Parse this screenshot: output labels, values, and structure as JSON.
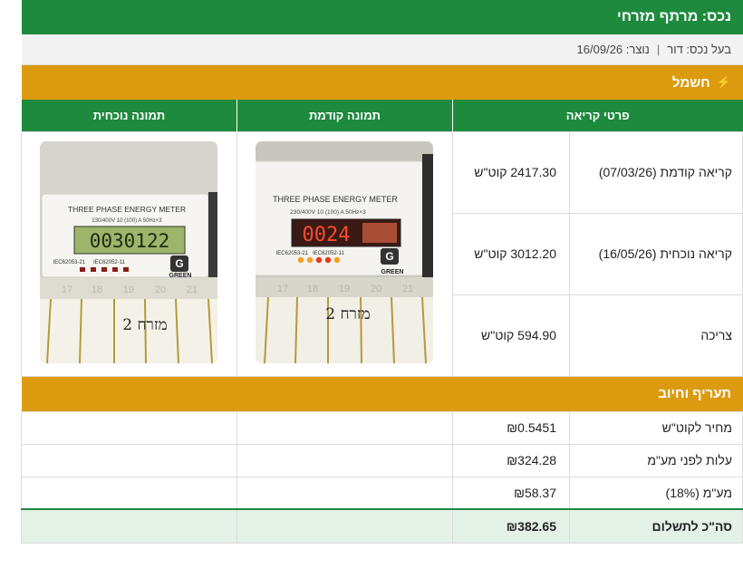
{
  "header": {
    "title": "נכס: מרתף מזרחי",
    "owner_text": "בעל נכס: דור",
    "created_text": "נוצר: 16/09/26"
  },
  "electricity": {
    "section_title": "חשמל",
    "icon": "lightning-icon",
    "columns": [
      "פרטי קריאה",
      "",
      "תמונה קודמת",
      "תמונה נוכחית"
    ],
    "rows": [
      {
        "label": "קריאה קודמת (07/03/26)",
        "value": "2417.30 קוט\"ש"
      },
      {
        "label": "קריאה נוכחית (16/05/26)",
        "value": "3012.20 קוט\"ש"
      },
      {
        "label": "צריכה",
        "value": "594.90 קוט\"ש"
      }
    ],
    "previous_photo": {
      "meter_title": "THREE PHASE ENERGY METER",
      "spec": "3×230/400V 10 (100) A 50Hz",
      "display": "0024",
      "std1": "IEC62053-21",
      "std2": "IEC62052-11",
      "brand": "GREEN",
      "handwriting": "מזרח 2",
      "display_color": "#d9341f",
      "scale": [
        "17",
        "18",
        "19",
        "20",
        "21"
      ]
    },
    "current_photo": {
      "meter_title": "THREE PHASE ENERGY METER",
      "spec": "3×230/400V 10 (100) A 50Hz",
      "display": "0030122",
      "std1": "IEC62053-21",
      "std2": "IEC62052-11",
      "brand": "GREEN",
      "handwriting": "מזרח 2",
      "display_color": "#7fa03a",
      "scale": [
        "17",
        "18",
        "19",
        "20",
        "21"
      ]
    }
  },
  "tariff": {
    "section_title": "תעריף וחיוב",
    "rows": [
      {
        "label": "מחיר לקוט\"ש",
        "value": "₪0.5451"
      },
      {
        "label": "עלות לפני מע\"מ",
        "value": "₪324.28"
      },
      {
        "label": "מע\"מ (18%)",
        "value": "₪58.37"
      }
    ],
    "total": {
      "label": "סה\"כ לתשלום",
      "value": "₪382.65"
    }
  },
  "colors": {
    "green": "#1e8a3e",
    "amber": "#dc9b0f",
    "total_bg": "#e3f1e7"
  }
}
